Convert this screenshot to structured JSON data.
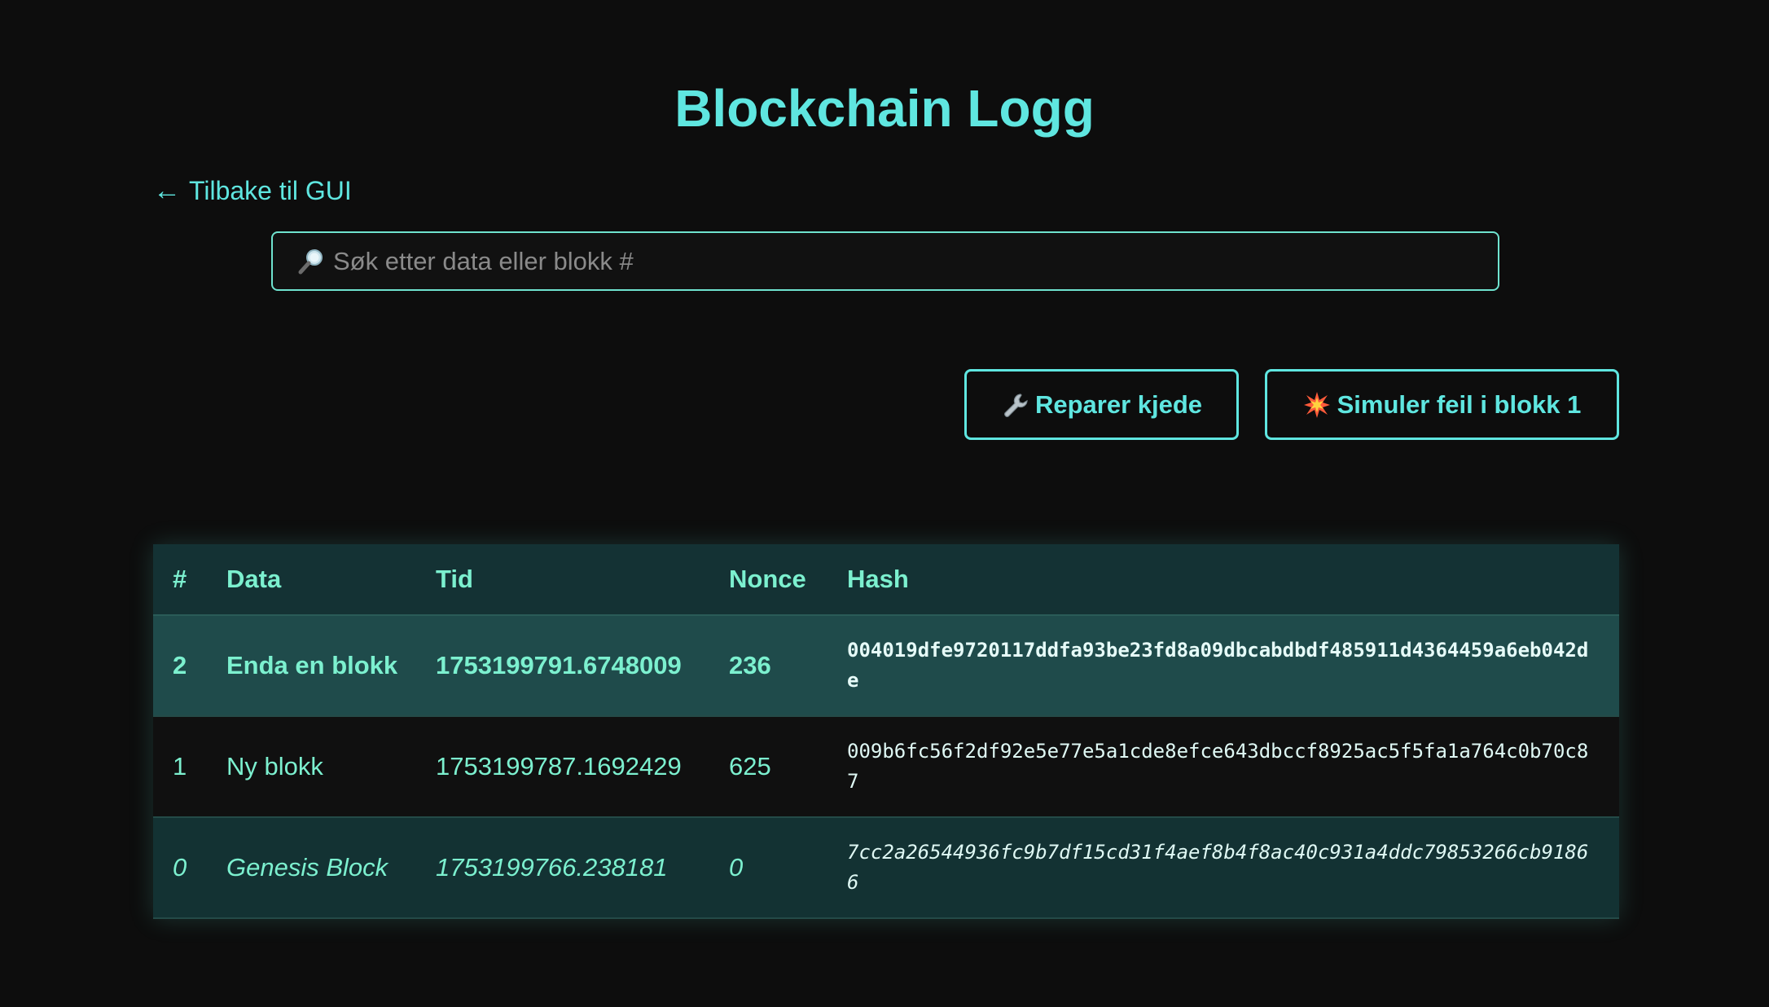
{
  "title": "Blockchain Logg",
  "back_link": {
    "arrow": "←",
    "label": "Tilbake til GUI"
  },
  "search": {
    "placeholder": "Søk etter data eller blokk #",
    "value": "",
    "icon": "magnifier-icon"
  },
  "actions": {
    "repair": {
      "icon": "wrench-icon",
      "label": "Reparer kjede"
    },
    "simulate": {
      "icon": "collision-icon",
      "label": "Simuler feil i blokk 1"
    }
  },
  "table": {
    "headers": {
      "num": "#",
      "data": "Data",
      "time": "Tid",
      "nonce": "Nonce",
      "hash": "Hash"
    },
    "rows": [
      {
        "num": "2",
        "data": "Enda en blokk",
        "time": "1753199791.6748009",
        "nonce": "236",
        "hash": "004019dfe9720117ddfa93be23fd8a09dbcabdbdf485911d4364459a6eb042de"
      },
      {
        "num": "1",
        "data": "Ny blokk",
        "time": "1753199787.1692429",
        "nonce": "625",
        "hash": "009b6fc56f2df92e5e77e5a1cde8efce643dbccf8925ac5f5fa1a764c0b70c87"
      },
      {
        "num": "0",
        "data": "Genesis Block",
        "time": "1753199766.238181",
        "nonce": "0",
        "hash": "7cc2a26544936fc9b7df15cd31f4aef8b4f8ac40c931a4ddc79853266cb91866"
      }
    ]
  },
  "colors": {
    "background": "#0d0d0d",
    "accent": "#5fe6e0",
    "text": "#7cf0cf",
    "header_row": "#143234",
    "highlight_row": "#1f4b4b"
  }
}
